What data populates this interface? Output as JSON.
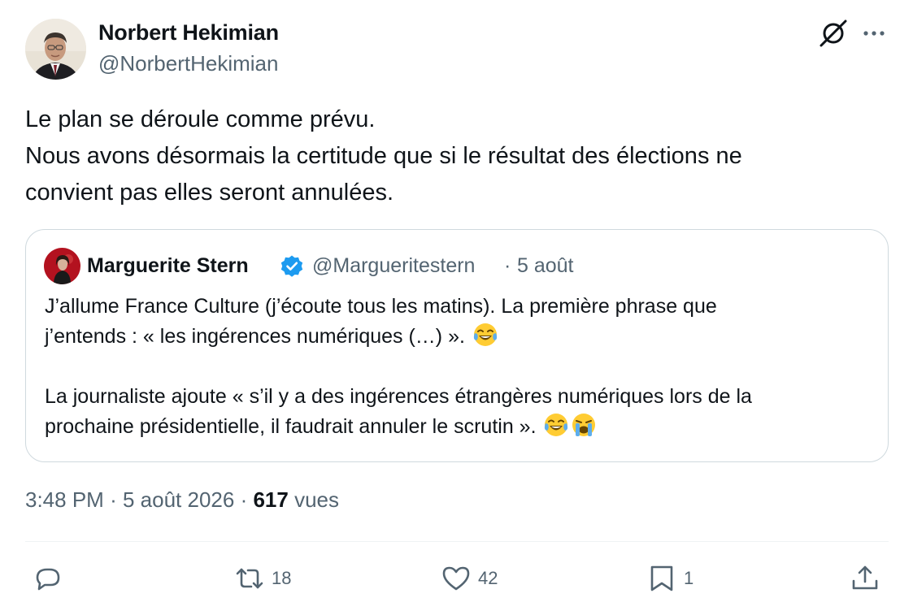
{
  "author": {
    "name": "Norbert Hekimian",
    "handle": "@NorbertHekimian"
  },
  "tweet": {
    "lines": [
      "Le plan se déroule comme prévu.",
      "Nous avons désormais la certitude que si le résultat des élections ne",
      "convient pas elles seront annulées."
    ]
  },
  "quote": {
    "name": "Marguerite Stern",
    "handle": "@Margueritestern",
    "separator": "·",
    "date": "5 août",
    "lines": [
      "J’allume France Culture (j’écoute tous les matins). La première phrase que",
      "j’entends : « les ingérences numériques (…) ».",
      "",
      "La journaliste ajoute « s’il y a des ingérences étrangères numériques lors de la",
      "prochaine présidentielle, il faudrait annuler le scrutin »."
    ]
  },
  "meta": {
    "time": "3:48 PM",
    "sep1": "·",
    "date": "5 août 2026",
    "sep2": "·",
    "views_count": "617",
    "views_label": "vues"
  },
  "actions": {
    "retweets": "18",
    "likes": "42",
    "bookmarks": "1"
  },
  "icons": {
    "reply": "reply-icon",
    "retweet": "retweet-icon",
    "like": "heart-icon",
    "bookmark": "bookmark-icon",
    "share": "share-icon",
    "grok": "grok-icon",
    "more": "more-icon",
    "verified": "verified-badge-icon"
  },
  "colors": {
    "text": "#0f1419",
    "secondary": "#536471",
    "border": "#cfd9de",
    "verified": "#1d9bf0"
  }
}
